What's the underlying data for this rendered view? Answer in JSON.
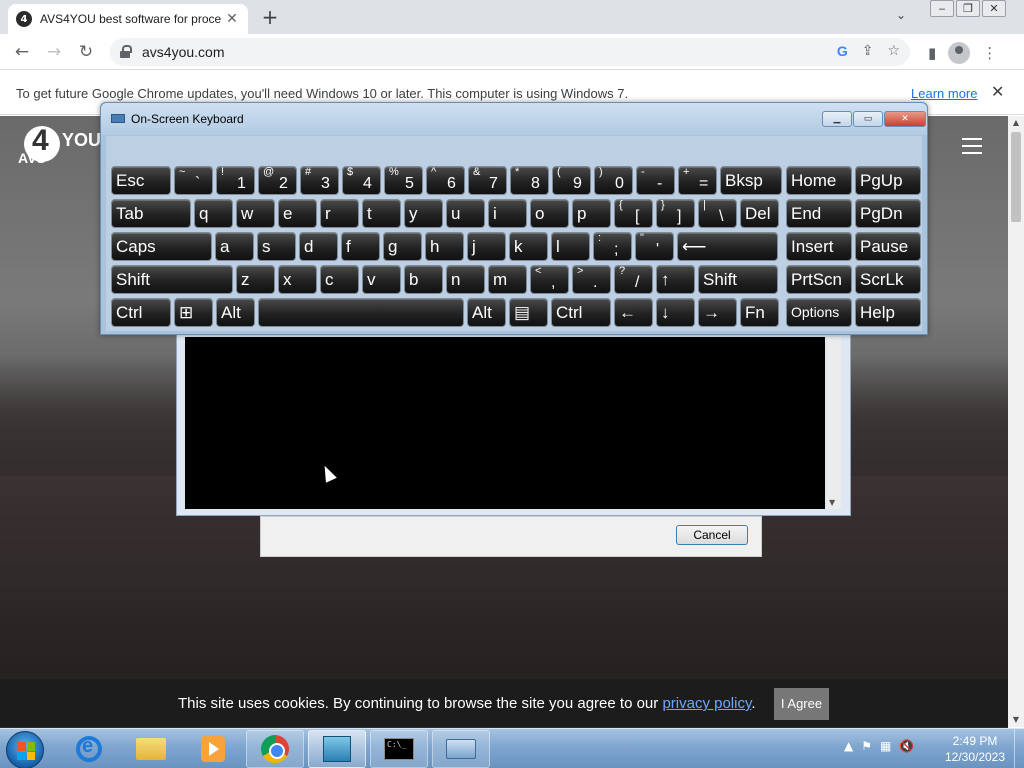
{
  "browser": {
    "tab": {
      "favicon": "4",
      "title": "AVS4YOU best software for proce"
    },
    "new_tab_icon": "+",
    "url": "avs4you.com",
    "window_controls": [
      "minimize",
      "restore",
      "close"
    ]
  },
  "infobar": {
    "message": "To get future Google Chrome updates, you'll need Windows 10 or later. This computer is using Windows 7.",
    "learn_more": "Learn more",
    "close": "✕"
  },
  "site": {
    "logo": {
      "digit": "4",
      "left": "AVS",
      "right": "YOU"
    }
  },
  "installer": {
    "cancel_label": "Cancel"
  },
  "osk": {
    "title": "On-Screen Keyboard",
    "rows": [
      [
        {
          "name": "esc",
          "label": "Esc"
        },
        {
          "name": "backtick",
          "shift": "~",
          "main": "`"
        },
        {
          "name": "1",
          "shift": "!",
          "main": "1"
        },
        {
          "name": "2",
          "shift": "@",
          "main": "2"
        },
        {
          "name": "3",
          "shift": "#",
          "main": "3"
        },
        {
          "name": "4",
          "shift": "$",
          "main": "4"
        },
        {
          "name": "5",
          "shift": "%",
          "main": "5"
        },
        {
          "name": "6",
          "shift": "^",
          "main": "6"
        },
        {
          "name": "7",
          "shift": "&",
          "main": "7"
        },
        {
          "name": "8",
          "shift": "*",
          "main": "8"
        },
        {
          "name": "9",
          "shift": "(",
          "main": "9"
        },
        {
          "name": "0",
          "shift": ")",
          "main": "0"
        },
        {
          "name": "minus",
          "shift": "-",
          "main": "-"
        },
        {
          "name": "equals",
          "shift": "+",
          "main": "="
        },
        {
          "name": "bksp",
          "label": "Bksp"
        },
        {
          "name": "home",
          "label": "Home"
        },
        {
          "name": "pgup",
          "label": "PgUp"
        }
      ],
      [
        {
          "name": "tab",
          "label": "Tab"
        },
        {
          "name": "q",
          "label": "q"
        },
        {
          "name": "w",
          "label": "w"
        },
        {
          "name": "e",
          "label": "e"
        },
        {
          "name": "r",
          "label": "r"
        },
        {
          "name": "t",
          "label": "t"
        },
        {
          "name": "y",
          "label": "y"
        },
        {
          "name": "u",
          "label": "u"
        },
        {
          "name": "i",
          "label": "i"
        },
        {
          "name": "o",
          "label": "o"
        },
        {
          "name": "p",
          "label": "p"
        },
        {
          "name": "lbracket",
          "shift": "{",
          "main": "["
        },
        {
          "name": "rbracket",
          "shift": "}",
          "main": "]"
        },
        {
          "name": "backslash",
          "shift": "|",
          "main": "\\"
        },
        {
          "name": "del",
          "label": "Del"
        },
        {
          "name": "end",
          "label": "End"
        },
        {
          "name": "pgdn",
          "label": "PgDn"
        }
      ],
      [
        {
          "name": "caps",
          "label": "Caps"
        },
        {
          "name": "a",
          "label": "a"
        },
        {
          "name": "s",
          "label": "s"
        },
        {
          "name": "d",
          "label": "d"
        },
        {
          "name": "f",
          "label": "f"
        },
        {
          "name": "g",
          "label": "g"
        },
        {
          "name": "h",
          "label": "h"
        },
        {
          "name": "j",
          "label": "j"
        },
        {
          "name": "k",
          "label": "k"
        },
        {
          "name": "l",
          "label": "l"
        },
        {
          "name": "semicolon",
          "shift": ":",
          "main": ";"
        },
        {
          "name": "quote",
          "shift": "\"",
          "main": "'"
        },
        {
          "name": "enter",
          "label": "⟵"
        },
        {
          "name": "insert",
          "label": "Insert"
        },
        {
          "name": "pause",
          "label": "Pause"
        }
      ],
      [
        {
          "name": "shift-left",
          "label": "Shift"
        },
        {
          "name": "z",
          "label": "z"
        },
        {
          "name": "x",
          "label": "x"
        },
        {
          "name": "c",
          "label": "c"
        },
        {
          "name": "v",
          "label": "v"
        },
        {
          "name": "b",
          "label": "b"
        },
        {
          "name": "n",
          "label": "n"
        },
        {
          "name": "m",
          "label": "m"
        },
        {
          "name": "comma",
          "shift": "<",
          "main": ","
        },
        {
          "name": "period",
          "shift": ">",
          "main": "."
        },
        {
          "name": "slash",
          "shift": "?",
          "main": "/"
        },
        {
          "name": "up",
          "label": "↑"
        },
        {
          "name": "shift-right",
          "label": "Shift"
        },
        {
          "name": "prtscn",
          "label": "PrtScn"
        },
        {
          "name": "scrlk",
          "label": "ScrLk"
        }
      ],
      [
        {
          "name": "ctrl-left",
          "label": "Ctrl"
        },
        {
          "name": "win",
          "label": "⊞"
        },
        {
          "name": "alt-left",
          "label": "Alt"
        },
        {
          "name": "space",
          "label": ""
        },
        {
          "name": "alt-right",
          "label": "Alt"
        },
        {
          "name": "menu",
          "label": "▤"
        },
        {
          "name": "ctrl-right",
          "label": "Ctrl"
        },
        {
          "name": "left",
          "label": "←"
        },
        {
          "name": "down",
          "label": "↓"
        },
        {
          "name": "right",
          "label": "→"
        },
        {
          "name": "fn",
          "label": "Fn"
        },
        {
          "name": "options",
          "label": "Options"
        },
        {
          "name": "help",
          "label": "Help"
        }
      ]
    ]
  },
  "cookie": {
    "text_before": "This site uses cookies. By continuing to browse the site you agree to our ",
    "link": "privacy policy",
    "text_after": ".",
    "agree": "I Agree"
  },
  "taskbar": {
    "apps": [
      "internet-explorer",
      "windows-explorer",
      "media-player",
      "chrome",
      "installer",
      "command-prompt",
      "on-screen-keyboard"
    ],
    "time": "2:49 PM",
    "date": "12/30/2023"
  }
}
